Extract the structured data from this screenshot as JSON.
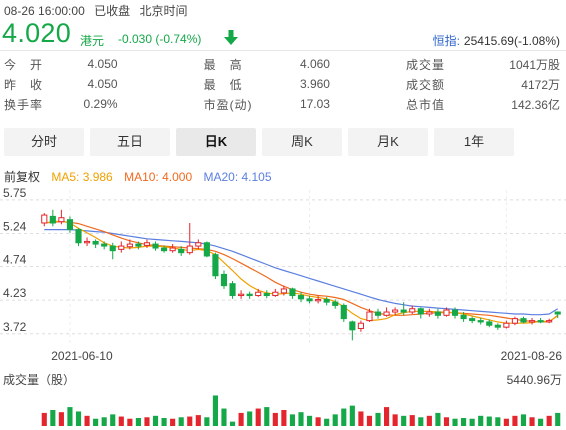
{
  "header": {
    "datetime": "08-26 16:00:00",
    "status": "已收盘",
    "timezone": "北京时间"
  },
  "quote": {
    "price": "4.020",
    "currency": "港元",
    "change": "-0.030 (-0.74%)",
    "index_name": "恒指:",
    "index_value": "25415.69(-1.08%)"
  },
  "stats": [
    [
      {
        "label": "今　开",
        "value": "4.050",
        "tone": ""
      },
      {
        "label": "最　高",
        "value": "4.060",
        "tone": "red"
      },
      {
        "label": "成交量",
        "value": "1041万股",
        "tone": ""
      }
    ],
    [
      {
        "label": "昨　收",
        "value": "4.050",
        "tone": ""
      },
      {
        "label": "最　低",
        "value": "3.960",
        "tone": "green"
      },
      {
        "label": "成交额",
        "value": "4172万",
        "tone": ""
      }
    ],
    [
      {
        "label": "换手率",
        "value": "0.29%",
        "tone": ""
      },
      {
        "label": "市盈(动)",
        "value": "17.03",
        "tone": ""
      },
      {
        "label": "总市值",
        "value": "142.36亿",
        "tone": ""
      }
    ]
  ],
  "tabs": [
    "分时",
    "五日",
    "日K",
    "周K",
    "月K",
    "1年"
  ],
  "active_tab": "日K",
  "ma": {
    "adjust": "前复权",
    "ma5": "MA5: 3.986",
    "ma10": "MA10: 4.000",
    "ma20": "MA20: 4.105",
    "colors": {
      "ma5": "#f0a000",
      "ma10": "#f06a1d",
      "ma20": "#5b7fe0"
    }
  },
  "colors": {
    "up": "#e3262d",
    "down": "#15a848",
    "flat": "#bbbbbb",
    "grid": "#dddddd"
  },
  "chart_data": {
    "type": "candlestick",
    "y_ticks": [
      "5.75",
      "5.24",
      "4.74",
      "4.23",
      "3.72"
    ],
    "y_tick_values": [
      5.75,
      5.24,
      4.74,
      4.23,
      3.72
    ],
    "ylim": [
      3.55,
      5.9
    ],
    "x_labels": [
      {
        "label": "2021-06-10",
        "index": 3
      },
      {
        "label": "2021-08-26",
        "index": 54
      }
    ],
    "candles": [
      [
        5.4,
        5.52,
        5.55,
        5.35
      ],
      [
        5.5,
        5.4,
        5.6,
        5.35
      ],
      [
        5.42,
        5.48,
        5.6,
        5.38
      ],
      [
        5.45,
        5.3,
        5.5,
        5.25
      ],
      [
        5.3,
        5.1,
        5.32,
        5.05
      ],
      [
        5.1,
        5.12,
        5.18,
        5.05
      ],
      [
        5.12,
        5.08,
        5.15,
        5.02
      ],
      [
        5.08,
        5.05,
        5.12,
        5.0
      ],
      [
        5.05,
        4.98,
        5.1,
        4.85
      ],
      [
        5.0,
        5.05,
        5.12,
        4.95
      ],
      [
        5.04,
        5.08,
        5.15,
        5.0
      ],
      [
        5.08,
        5.05,
        5.12,
        5.0
      ],
      [
        5.06,
        5.1,
        5.15,
        5.02
      ],
      [
        5.08,
        5.02,
        5.12,
        4.98
      ],
      [
        5.02,
        4.98,
        5.06,
        4.95
      ],
      [
        4.98,
        5.02,
        5.08,
        4.95
      ],
      [
        5.0,
        4.95,
        5.05,
        4.9
      ],
      [
        4.95,
        5.05,
        5.4,
        4.92
      ],
      [
        5.05,
        5.1,
        5.15,
        5.0
      ],
      [
        5.1,
        4.9,
        5.12,
        4.88
      ],
      [
        4.92,
        4.6,
        4.95,
        4.55
      ],
      [
        4.62,
        4.45,
        4.68,
        4.4
      ],
      [
        4.48,
        4.3,
        4.52,
        4.25
      ],
      [
        4.3,
        4.32,
        4.38,
        4.25
      ],
      [
        4.32,
        4.3,
        4.36,
        4.25
      ],
      [
        4.3,
        4.35,
        4.4,
        4.28
      ],
      [
        4.33,
        4.3,
        4.38,
        4.26
      ],
      [
        4.3,
        4.35,
        4.4,
        4.28
      ],
      [
        4.34,
        4.4,
        4.45,
        4.3
      ],
      [
        4.4,
        4.3,
        4.42,
        4.25
      ],
      [
        4.3,
        4.25,
        4.35,
        4.2
      ],
      [
        4.25,
        4.22,
        4.3,
        4.18
      ],
      [
        4.22,
        4.24,
        4.3,
        4.18
      ],
      [
        4.24,
        4.2,
        4.28,
        4.15
      ],
      [
        4.2,
        4.15,
        4.24,
        4.1
      ],
      [
        4.15,
        3.95,
        4.18,
        3.9
      ],
      [
        3.9,
        3.78,
        3.92,
        3.62
      ],
      [
        3.8,
        3.88,
        3.92,
        3.75
      ],
      [
        3.92,
        4.05,
        4.1,
        3.9
      ],
      [
        4.05,
        4.0,
        4.1,
        3.95
      ],
      [
        4.0,
        4.05,
        4.12,
        3.98
      ],
      [
        4.05,
        4.08,
        4.12,
        4.0
      ],
      [
        4.08,
        4.05,
        4.2,
        4.0
      ],
      [
        4.05,
        4.1,
        4.15,
        4.02
      ],
      [
        4.1,
        4.02,
        4.12,
        3.95
      ],
      [
        4.02,
        4.05,
        4.1,
        3.98
      ],
      [
        4.05,
        4.0,
        4.1,
        3.95
      ],
      [
        4.0,
        4.08,
        4.12,
        3.98
      ],
      [
        4.08,
        4.0,
        4.12,
        3.95
      ],
      [
        4.0,
        3.95,
        4.05,
        3.9
      ],
      [
        3.95,
        3.92,
        3.98,
        3.88
      ],
      [
        3.92,
        3.9,
        3.96,
        3.86
      ],
      [
        3.9,
        3.85,
        3.94,
        3.82
      ],
      [
        3.85,
        3.82,
        3.88,
        3.78
      ],
      [
        3.82,
        3.88,
        3.92,
        3.8
      ],
      [
        3.88,
        3.95,
        3.98,
        3.85
      ],
      [
        3.95,
        3.9,
        3.98,
        3.88
      ],
      [
        3.9,
        3.92,
        3.96,
        3.86
      ],
      [
        3.92,
        3.9,
        3.96,
        3.88
      ],
      [
        3.9,
        3.92,
        3.95,
        3.88
      ],
      [
        4.05,
        4.02,
        4.06,
        3.96
      ]
    ],
    "ma5": [
      5.4,
      5.42,
      5.43,
      5.4,
      5.32,
      5.25,
      5.18,
      5.1,
      5.05,
      5.03,
      5.02,
      5.03,
      5.05,
      5.05,
      5.04,
      5.02,
      5.0,
      4.98,
      5.0,
      4.98,
      4.92,
      4.8,
      4.68,
      4.55,
      4.45,
      4.38,
      4.34,
      4.32,
      4.33,
      4.34,
      4.32,
      4.29,
      4.27,
      4.25,
      4.21,
      4.13,
      4.03,
      3.95,
      3.92,
      3.93,
      3.95,
      4.01,
      4.04,
      4.06,
      4.06,
      4.06,
      4.05,
      4.05,
      4.04,
      4.02,
      3.99,
      3.96,
      3.93,
      3.9,
      3.88,
      3.88,
      3.88,
      3.89,
      3.91,
      3.91,
      3.99
    ],
    "ma10": [
      5.4,
      5.41,
      5.42,
      5.41,
      5.39,
      5.35,
      5.31,
      5.27,
      5.22,
      5.17,
      5.13,
      5.1,
      5.07,
      5.06,
      5.05,
      5.04,
      5.03,
      5.02,
      5.01,
      5.0,
      4.97,
      4.92,
      4.86,
      4.79,
      4.72,
      4.65,
      4.58,
      4.5,
      4.44,
      4.39,
      4.35,
      4.32,
      4.3,
      4.29,
      4.27,
      4.24,
      4.18,
      4.12,
      4.07,
      4.03,
      4.01,
      4.0,
      4.0,
      4.01,
      4.02,
      4.03,
      4.04,
      4.04,
      4.04,
      4.03,
      4.02,
      4.01,
      4.0,
      3.98,
      3.96,
      3.94,
      3.92,
      3.91,
      3.9,
      3.9,
      4.0
    ],
    "ma20": [
      5.3,
      5.3,
      5.3,
      5.3,
      5.29,
      5.28,
      5.27,
      5.26,
      5.24,
      5.22,
      5.2,
      5.18,
      5.16,
      5.15,
      5.14,
      5.13,
      5.12,
      5.11,
      5.1,
      5.08,
      5.05,
      5.01,
      4.97,
      4.92,
      4.87,
      4.82,
      4.77,
      4.72,
      4.68,
      4.64,
      4.6,
      4.56,
      4.52,
      4.48,
      4.44,
      4.4,
      4.36,
      4.32,
      4.28,
      4.24,
      4.21,
      4.18,
      4.16,
      4.14,
      4.13,
      4.12,
      4.11,
      4.1,
      4.09,
      4.08,
      4.07,
      4.06,
      4.05,
      4.04,
      4.03,
      4.02,
      4.02,
      4.01,
      4.01,
      4.02,
      4.1
    ],
    "volume_label": "成交量（股）",
    "volume_max_label": "5440.96万",
    "volume_max": 5440.96,
    "volumes": [
      900,
      1100,
      950,
      1300,
      1000,
      700,
      500,
      600,
      800,
      650,
      500,
      550,
      600,
      700,
      550,
      500,
      600,
      650,
      750,
      600,
      2100,
      1200,
      300,
      900,
      1000,
      1200,
      1300,
      900,
      1100,
      800,
      950,
      700,
      600,
      500,
      800,
      1200,
      1400,
      1000,
      700,
      900,
      1300,
      800,
      700,
      750,
      600,
      700,
      900,
      600,
      500,
      550,
      500,
      700,
      650,
      600,
      500,
      700,
      800,
      600,
      500,
      700,
      900
    ]
  }
}
